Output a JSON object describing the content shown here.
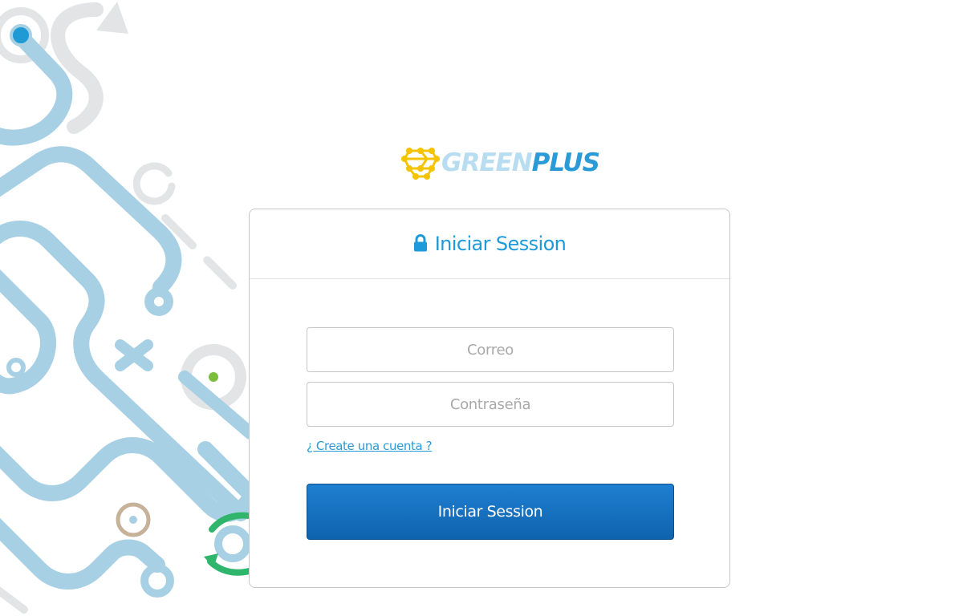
{
  "brand": {
    "name_part1": "GREEN",
    "name_part2": "PLUS"
  },
  "login": {
    "title": "Iniciar Session",
    "email_placeholder": "Correo",
    "password_placeholder": "Contraseña",
    "create_account_link": "¿ Create una cuenta ?",
    "submit_label": "Iniciar Session"
  },
  "icons": {
    "logo": "molecule-icon",
    "title": "lock-icon"
  },
  "colors": {
    "accent": "#1d9ad9",
    "button": "#1470c0",
    "brand_light": "#b9ddf0",
    "brand_dark": "#2a9bd6",
    "logo_mark": "#f5c400"
  }
}
